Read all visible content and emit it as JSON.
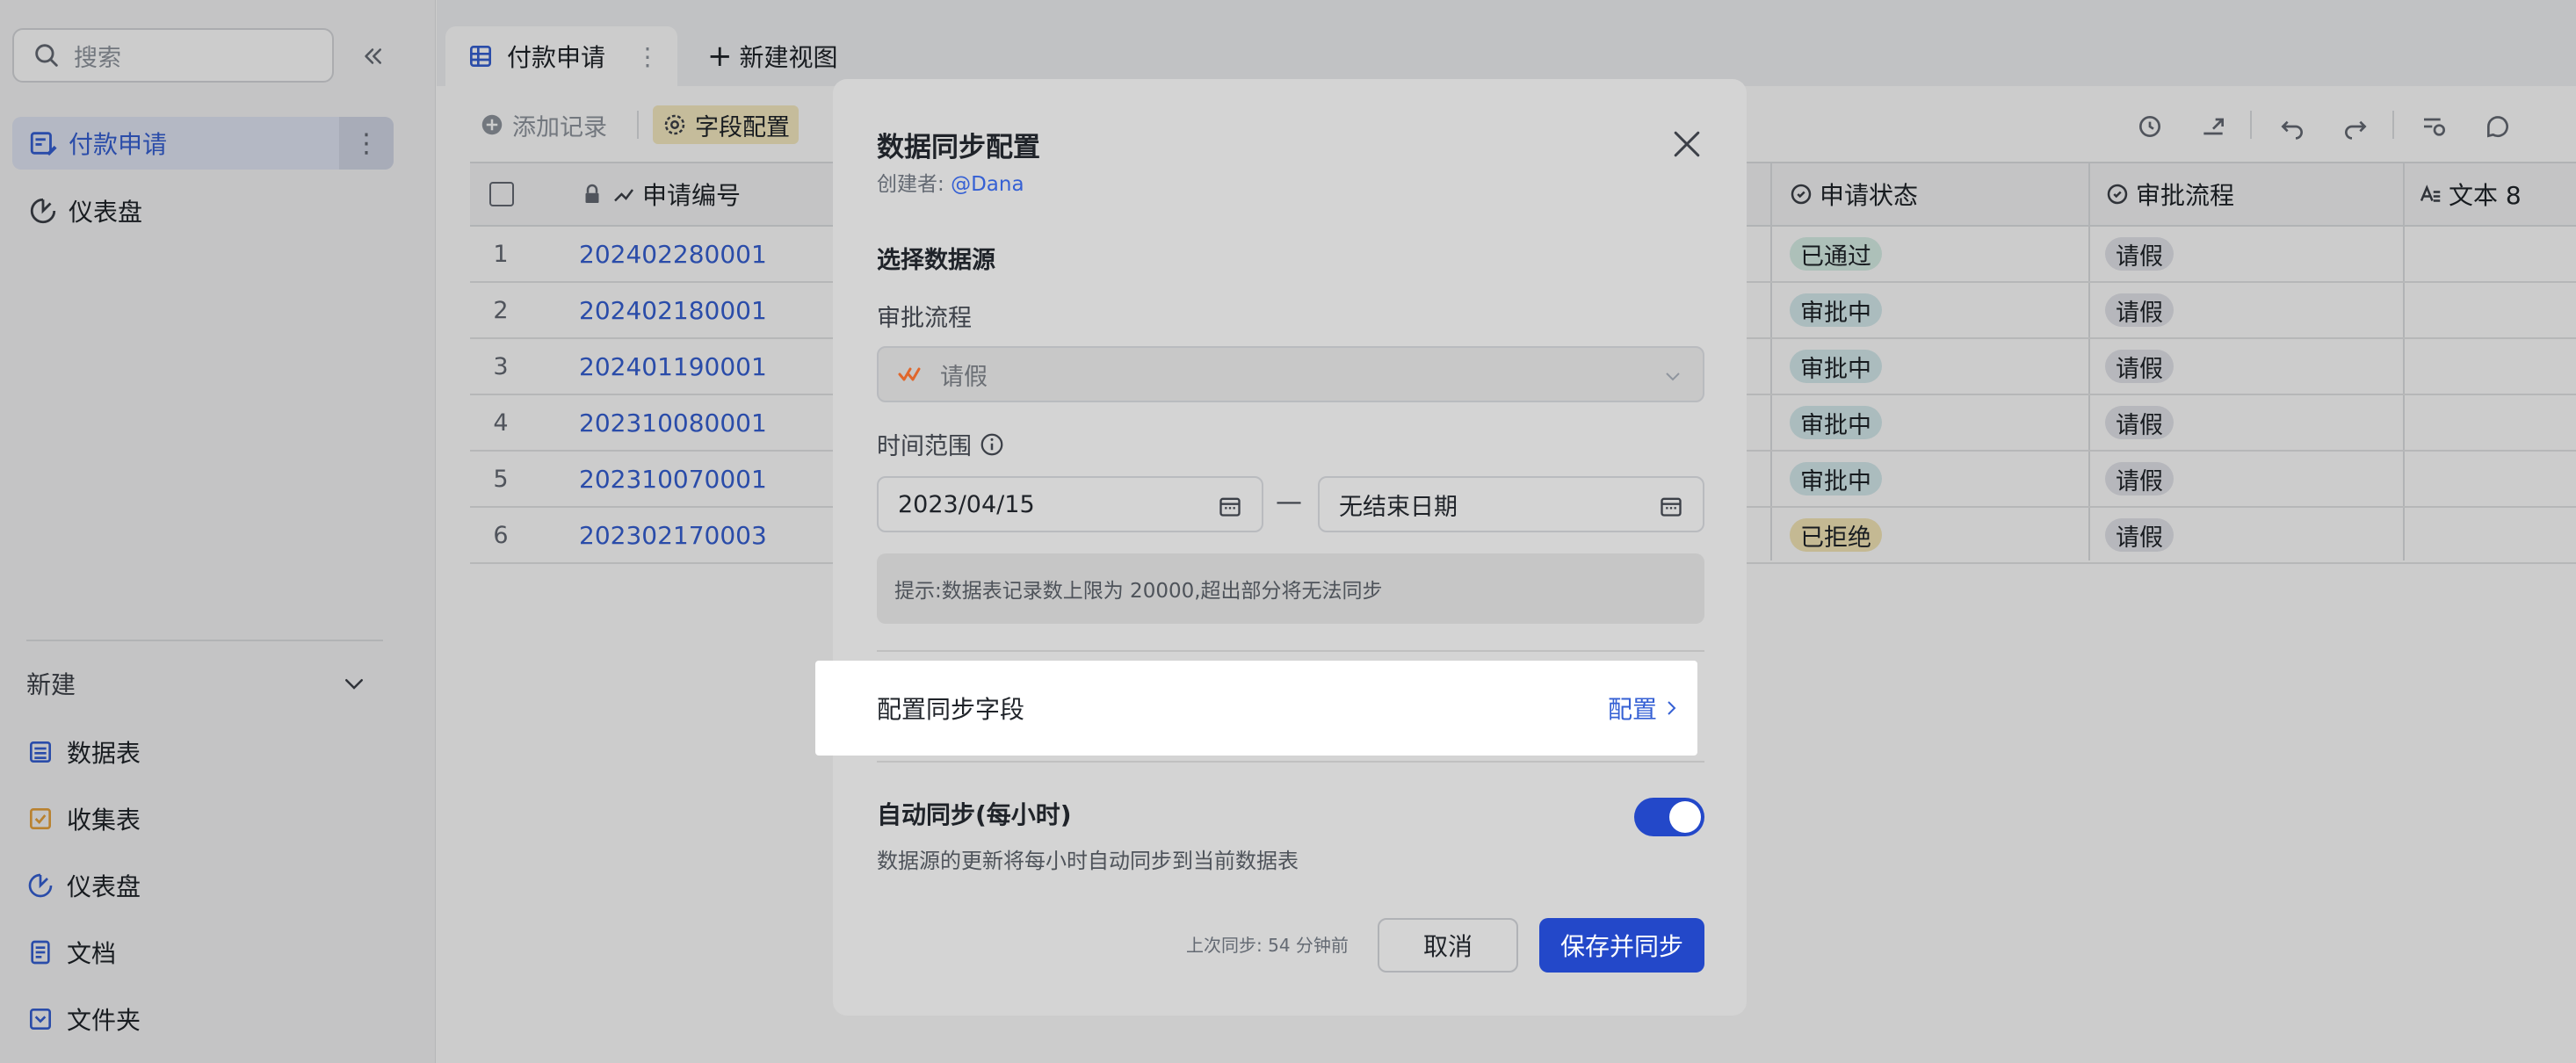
{
  "sidebar": {
    "search_placeholder": "搜索",
    "items": [
      {
        "label": "付款申请"
      },
      {
        "label": "仪表盘"
      }
    ],
    "new_section": {
      "title": "新建",
      "items": [
        {
          "label": "数据表"
        },
        {
          "label": "收集表"
        },
        {
          "label": "仪表盘"
        },
        {
          "label": "文档"
        },
        {
          "label": "文件夹"
        }
      ]
    }
  },
  "tabs": {
    "active": "付款申请",
    "new_view": "新建视图"
  },
  "toolbar": {
    "add_record": "添加记录",
    "field_config": "字段配置"
  },
  "table": {
    "columns": {
      "id": "申请编号",
      "status": "申请状态",
      "flow": "审批流程",
      "text8": "文本 8"
    },
    "rows": [
      {
        "num": "1",
        "id": "202402280001",
        "status": "已通过",
        "flow": "请假"
      },
      {
        "num": "2",
        "id": "202402180001",
        "status": "审批中",
        "flow": "请假"
      },
      {
        "num": "3",
        "id": "202401190001",
        "status": "审批中",
        "flow": "请假"
      },
      {
        "num": "4",
        "id": "202310080001",
        "status": "审批中",
        "flow": "请假"
      },
      {
        "num": "5",
        "id": "202310070001",
        "status": "审批中",
        "flow": "请假"
      },
      {
        "num": "6",
        "id": "202302170003",
        "status": "已拒绝",
        "flow": "请假"
      }
    ]
  },
  "modal": {
    "title": "数据同步配置",
    "creator_label": "创建者:",
    "creator_name": "@Dana",
    "section_title": "选择数据源",
    "flow_label": "审批流程",
    "flow_value": "请假",
    "time_label": "时间范围",
    "date_start": "2023/04/15",
    "date_end": "无结束日期",
    "date_sep": "—",
    "hint": "提示:数据表记录数上限为 20000,超出部分将无法同步",
    "sync_field_label": "配置同步字段",
    "config_link": "配置",
    "auto_sync_title": "自动同步(每小时)",
    "auto_sync_desc": "数据源的更新将每小时自动同步到当前数据表",
    "auto_sync_on": true,
    "last_sync": "上次同步: 54 分钟前",
    "cancel": "取消",
    "save": "保存并同步"
  },
  "colors": {
    "accent": "#2348c9",
    "link": "#3560d4",
    "status_passed": "#d9f0e8",
    "status_pending": "#d6ecee",
    "status_rejected": "#f5e8b8"
  }
}
